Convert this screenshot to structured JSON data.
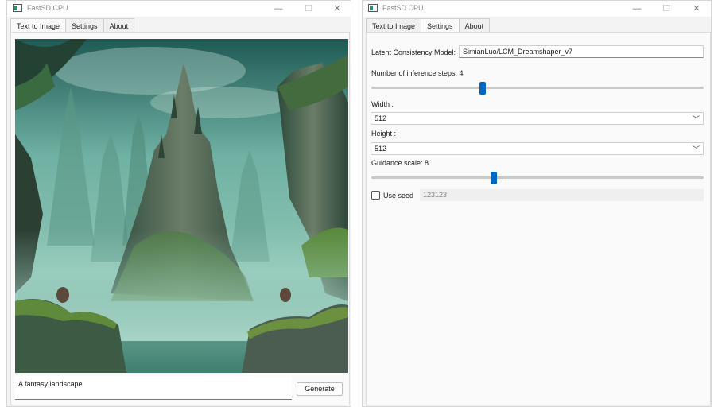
{
  "left_window": {
    "title": "FastSD CPU",
    "tabs": [
      {
        "label": "Text to Image",
        "active": true
      },
      {
        "label": "Settings",
        "active": false
      },
      {
        "label": "About",
        "active": false
      }
    ],
    "image_alt": "generated fantasy landscape",
    "prompt_value": "A fantasy landscape",
    "generate_label": "Generate"
  },
  "right_window": {
    "title": "FastSD CPU",
    "tabs": [
      {
        "label": "Text to Image",
        "active": false
      },
      {
        "label": "Settings",
        "active": true
      },
      {
        "label": "About",
        "active": false
      }
    ],
    "settings": {
      "model_label": "Latent Consistency Model:",
      "model_value": "SimianLuo/LCM_Dreamshaper_v7",
      "steps_label": "Number of inference steps: 4",
      "steps_value": 4,
      "width_label": "Width :",
      "width_value": "512",
      "height_label": "Height :",
      "height_value": "512",
      "guidance_label": "Guidance scale: 8",
      "guidance_value": 8,
      "use_seed_label": "Use seed",
      "use_seed_checked": false,
      "seed_value": "123123"
    }
  },
  "colors": {
    "accent": "#0067c0",
    "window_bg": "#f3f3f3",
    "panel_bg": "#fafafa"
  }
}
